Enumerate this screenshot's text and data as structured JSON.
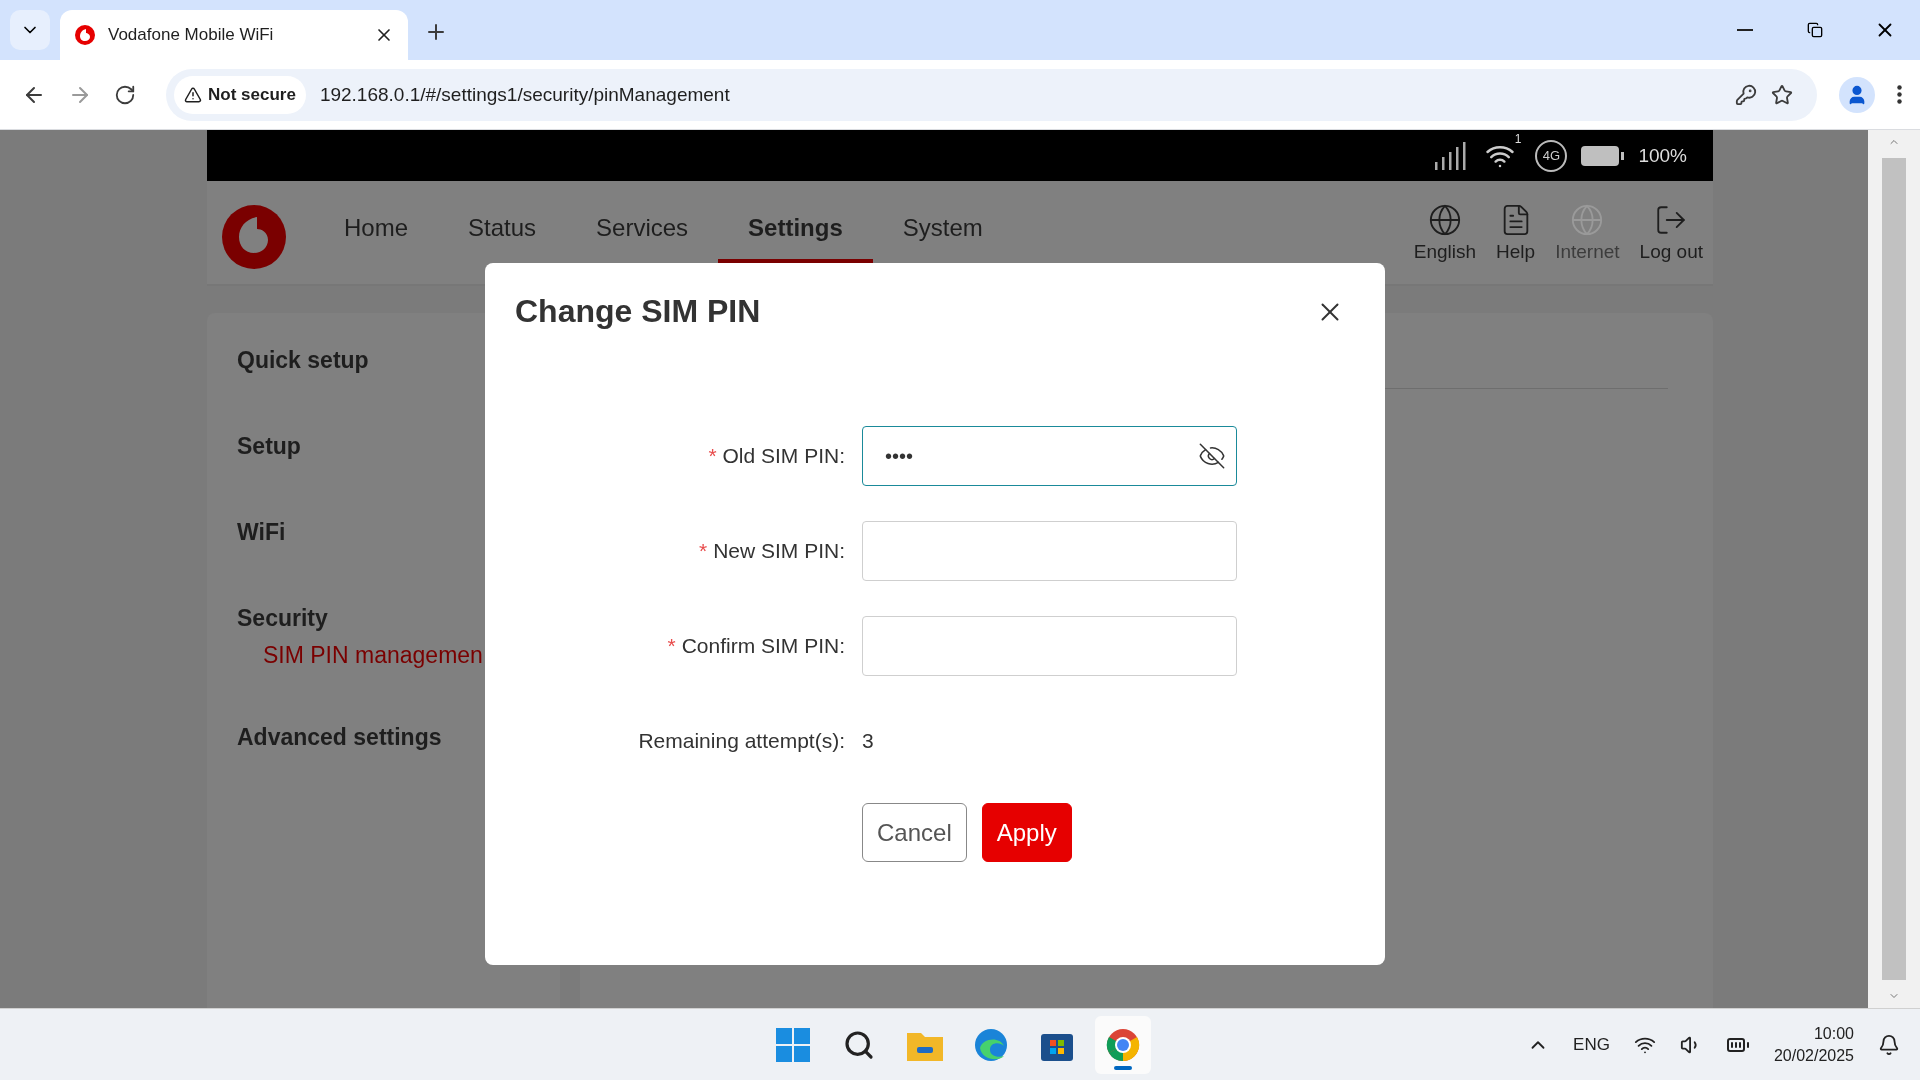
{
  "browser": {
    "tabs": [
      {
        "title": "Vodafone Mobile WiFi",
        "selected": true
      }
    ],
    "address": {
      "security": "Not secure",
      "url": "192.168.0.1/#/settings1/security/pinManagement"
    }
  },
  "router": {
    "status_bar": {
      "wifi_clients": "1",
      "network": "4G",
      "battery": "100%"
    },
    "nav": [
      {
        "label": "Home",
        "selected": false
      },
      {
        "label": "Status",
        "selected": false
      },
      {
        "label": "Services",
        "selected": false
      },
      {
        "label": "Settings",
        "selected": true
      },
      {
        "label": "System",
        "selected": false
      }
    ],
    "actions": [
      {
        "kind": "language",
        "label": "English",
        "disabled": false
      },
      {
        "kind": "help",
        "label": "Help",
        "disabled": false
      },
      {
        "kind": "internet",
        "label": "Internet",
        "disabled": true
      },
      {
        "kind": "logout",
        "label": "Log out",
        "disabled": false
      }
    ],
    "sidebar": [
      {
        "label": "Quick setup"
      },
      {
        "label": "Setup"
      },
      {
        "label": "WiFi"
      },
      {
        "label": "Security",
        "children": [
          {
            "label": "SIM PIN managemen",
            "selected": true
          }
        ]
      },
      {
        "label": "Advanced settings"
      }
    ]
  },
  "dialog": {
    "title": "Change SIM PIN",
    "fields": [
      {
        "label": "Old SIM PIN:",
        "required_mark": "*",
        "value": "••••",
        "focused": true,
        "kind": "password"
      },
      {
        "label": "New SIM PIN:",
        "required_mark": "*",
        "focused": false,
        "kind": "text"
      },
      {
        "label": "Confirm SIM PIN:",
        "required_mark": "*",
        "focused": false,
        "kind": "text"
      }
    ],
    "remaining": {
      "label": "Remaining attempt(s):",
      "value": "3"
    },
    "buttons": [
      {
        "label": "Cancel",
        "kind": "secondary"
      },
      {
        "label": "Apply",
        "kind": "primary"
      }
    ]
  },
  "taskbar": {
    "apps": [
      {
        "kind": "start",
        "active": false
      },
      {
        "kind": "search",
        "active": false
      },
      {
        "kind": "files",
        "active": false
      },
      {
        "kind": "edge",
        "active": false
      },
      {
        "kind": "store",
        "active": false
      },
      {
        "kind": "chrome",
        "active": true
      }
    ],
    "language": "ENG",
    "time": "10:00",
    "date": "20/02/2025"
  }
}
